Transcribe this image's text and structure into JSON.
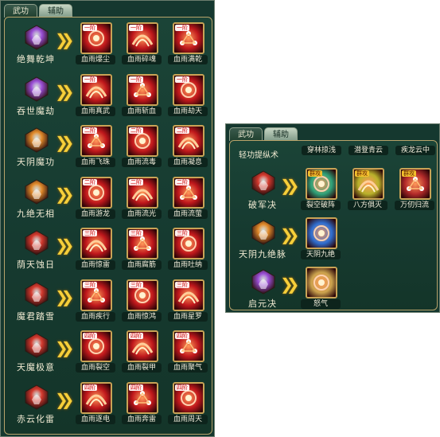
{
  "left_panel": {
    "tabs": [
      {
        "label": "武功",
        "active": false
      },
      {
        "label": "辅助",
        "active": true
      }
    ],
    "rows": [
      {
        "sect": "绝舞乾坤",
        "sect_color": "#9a4fd6",
        "skills": [
          {
            "name": "血雨爆尘",
            "tier": "一阶"
          },
          {
            "name": "血雨碎魂",
            "tier": "一阶"
          },
          {
            "name": "血雨满乾",
            "tier": "一阶"
          }
        ]
      },
      {
        "sect": "吞世魔劫",
        "sect_color": "#9a4fd6",
        "skills": [
          {
            "name": "血雨真武",
            "tier": "一阶"
          },
          {
            "name": "血雨斩血",
            "tier": "一阶"
          },
          {
            "name": "血雨劫天",
            "tier": "一阶"
          }
        ]
      },
      {
        "sect": "天阴魔功",
        "sect_color": "#e08a2a",
        "skills": [
          {
            "name": "血雨飞珠",
            "tier": "二阶"
          },
          {
            "name": "血雨流毒",
            "tier": "二阶"
          },
          {
            "name": "血雨凝息",
            "tier": "二阶"
          }
        ]
      },
      {
        "sect": "九绝无相",
        "sect_color": "#e08a2a",
        "skills": [
          {
            "name": "血雨游龙",
            "tier": "二阶"
          },
          {
            "name": "血雨流光",
            "tier": "二阶"
          },
          {
            "name": "血雨流萤",
            "tier": "二阶"
          }
        ]
      },
      {
        "sect": "荫天蚀日",
        "sect_color": "#d43a2e",
        "skills": [
          {
            "name": "血雨惊雷",
            "tier": "三阶"
          },
          {
            "name": "血雨腐筋",
            "tier": "三阶"
          },
          {
            "name": "血雨吐纳",
            "tier": "三阶"
          }
        ]
      },
      {
        "sect": "魔君踏雪",
        "sect_color": "#d43a2e",
        "skills": [
          {
            "name": "血雨疾行",
            "tier": "三阶"
          },
          {
            "name": "血雨惊鸿",
            "tier": "三阶"
          },
          {
            "name": "血雨星罗",
            "tier": "三阶"
          }
        ]
      },
      {
        "sect": "天魔极意",
        "sect_color": "#d43a2e",
        "skills": [
          {
            "name": "血雨裂空",
            "tier": "四阶"
          },
          {
            "name": "血雨裂甲",
            "tier": "四阶"
          },
          {
            "name": "血雨聚气",
            "tier": "四阶"
          }
        ]
      },
      {
        "sect": "赤云化雷",
        "sect_color": "#d43a2e",
        "skills": [
          {
            "name": "血雨逐电",
            "tier": "四阶"
          },
          {
            "name": "血雨奔雷",
            "tier": "四阶"
          },
          {
            "name": "血雨周天",
            "tier": "四阶"
          }
        ]
      }
    ]
  },
  "right_panel": {
    "tabs": [
      {
        "label": "武功",
        "active": false
      },
      {
        "label": "辅助",
        "active": true
      }
    ],
    "header_row": {
      "sect": "轻功提纵术",
      "skills": [
        "穿林掠浅",
        "潜登青云",
        "疾龙云中"
      ]
    },
    "rows": [
      {
        "sect": "破军决",
        "sect_color": "#d43a2e",
        "skills": [
          {
            "name": "裂空破阵",
            "tier": "群攻",
            "tint": "#2fa37a"
          },
          {
            "name": "八方俱灭",
            "tier": "群攻",
            "tint": "#b8b12a"
          },
          {
            "name": "万仞归流",
            "tier": "群攻",
            "tint": "#b32a2a"
          }
        ]
      },
      {
        "sect": "天阴九绝脉",
        "sect_color": "#e08a2a",
        "skills": [
          {
            "name": "天阴九绝",
            "tier": "",
            "tint": "#2f6fd1"
          }
        ]
      },
      {
        "sect": "启元决",
        "sect_color": "#9a4fd6",
        "skills": [
          {
            "name": "怒气",
            "tier": "",
            "tint": "#caa24d"
          }
        ]
      }
    ]
  },
  "colors": {
    "panel_bg": "#15382f",
    "gold_border": "#c9a356",
    "arrow": "#f6cf3a",
    "skill_red": "#c0181c"
  }
}
